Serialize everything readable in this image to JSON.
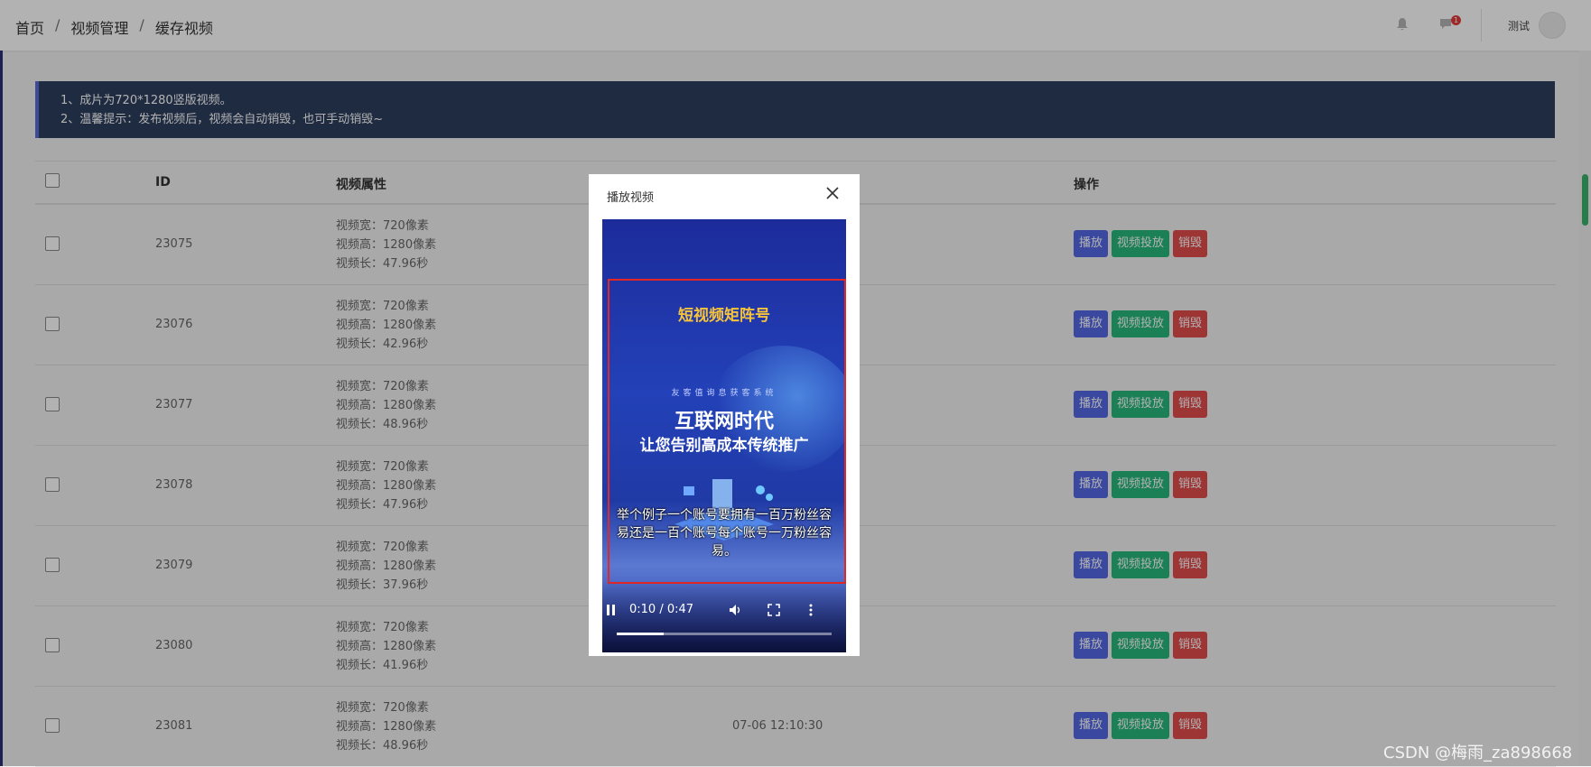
{
  "breadcrumb": [
    "首页",
    "视频管理",
    "缓存视频"
  ],
  "header": {
    "notification_count": "1",
    "user_name": "测试"
  },
  "notice": {
    "lines": [
      "1、成片为720*1280竖版视频。",
      "2、温馨提示：发布视频后，视频会自动销毁，也可手动销毁~"
    ]
  },
  "table": {
    "columns": {
      "id": "ID",
      "attr": "视频属性",
      "ops": "操作"
    },
    "rows": [
      {
        "id": "23075",
        "width": "视频宽：720像素",
        "height": "视频高：1280像素",
        "length": "视频长：47.96秒",
        "time": ""
      },
      {
        "id": "23076",
        "width": "视频宽：720像素",
        "height": "视频高：1280像素",
        "length": "视频长：42.96秒",
        "time": ""
      },
      {
        "id": "23077",
        "width": "视频宽：720像素",
        "height": "视频高：1280像素",
        "length": "视频长：48.96秒",
        "time": ""
      },
      {
        "id": "23078",
        "width": "视频宽：720像素",
        "height": "视频高：1280像素",
        "length": "视频长：47.96秒",
        "time": ""
      },
      {
        "id": "23079",
        "width": "视频宽：720像素",
        "height": "视频高：1280像素",
        "length": "视频长：37.96秒",
        "time": ""
      },
      {
        "id": "23080",
        "width": "视频宽：720像素",
        "height": "视频高：1280像素",
        "length": "视频长：41.96秒",
        "time": ""
      },
      {
        "id": "23081",
        "width": "视频宽：720像素",
        "height": "视频高：1280像素",
        "length": "视频长：48.96秒",
        "time": "07-06 12:10:30"
      }
    ],
    "buttons": {
      "play": "播放",
      "publish": "视频投放",
      "delete": "销毁"
    }
  },
  "modal": {
    "title": "播放视频",
    "video": {
      "headline": "短视频矩阵号",
      "kicker": "友客值询息获客系统",
      "main_line1": "互联网时代",
      "main_line2": "让您告别高成本传统推广",
      "subtitle": "举个例子一个账号要拥有一百万粉丝容易还是一百个账号每个账号一万粉丝容易。",
      "time": "0:10 / 0:47",
      "progress": 0.22
    }
  },
  "watermark": "CSDN @梅雨_za898668",
  "icons": [
    "bell-icon",
    "chat-icon",
    "close-icon",
    "pause-icon",
    "volume-icon",
    "fullscreen-icon",
    "more-icon"
  ]
}
